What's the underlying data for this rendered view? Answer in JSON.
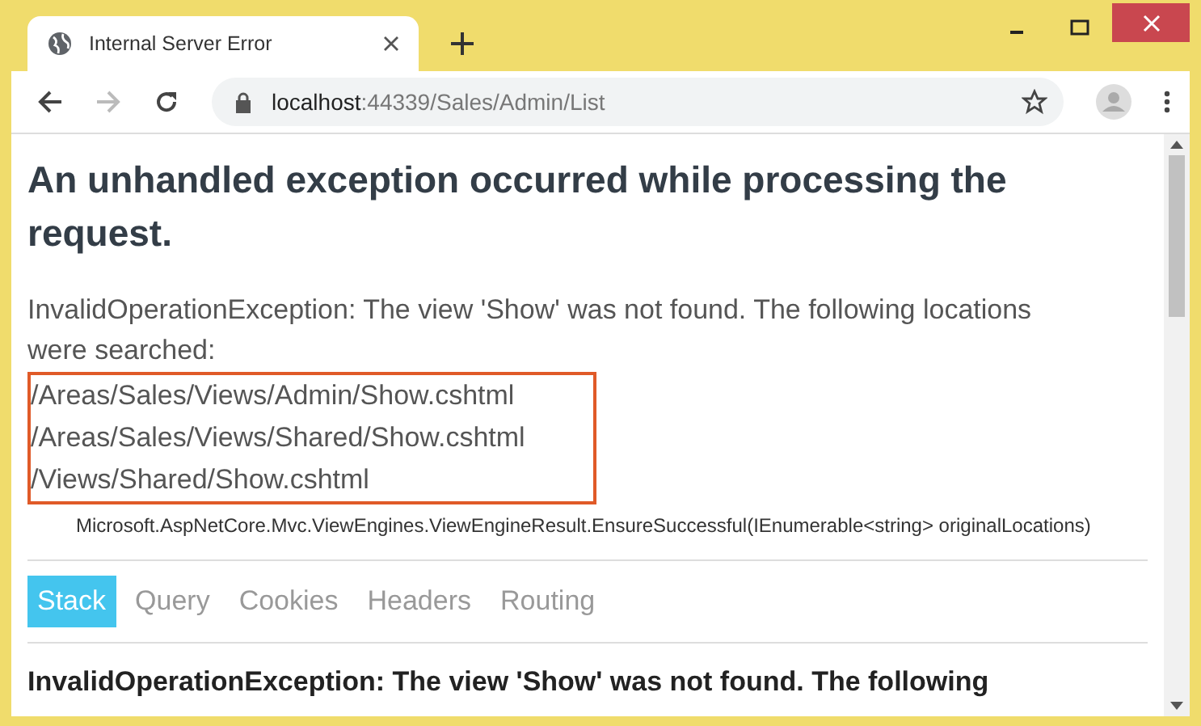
{
  "tabs": [
    {
      "title": "Internal Server Error"
    }
  ],
  "address_bar": {
    "host": "localhost",
    "path": ":44339/Sales/Admin/List"
  },
  "page": {
    "heading": "An unhandled exception occurred while processing the request.",
    "message": "InvalidOperationException: The view 'Show' was not found. The following locations were searched:",
    "locations": [
      "/Areas/Sales/Views/Admin/Show.cshtml",
      "/Areas/Sales/Views/Shared/Show.cshtml",
      "/Views/Shared/Show.cshtml"
    ],
    "source": "Microsoft.AspNetCore.Mvc.ViewEngines.ViewEngineResult.EnsureSuccessful(IEnumerable<string> originalLocations)",
    "tabs": [
      {
        "label": "Stack",
        "selected": true
      },
      {
        "label": "Query",
        "selected": false
      },
      {
        "label": "Cookies",
        "selected": false
      },
      {
        "label": "Headers",
        "selected": false
      },
      {
        "label": "Routing",
        "selected": false
      }
    ],
    "stack_heading": "InvalidOperationException: The view 'Show' was not found. The following"
  }
}
